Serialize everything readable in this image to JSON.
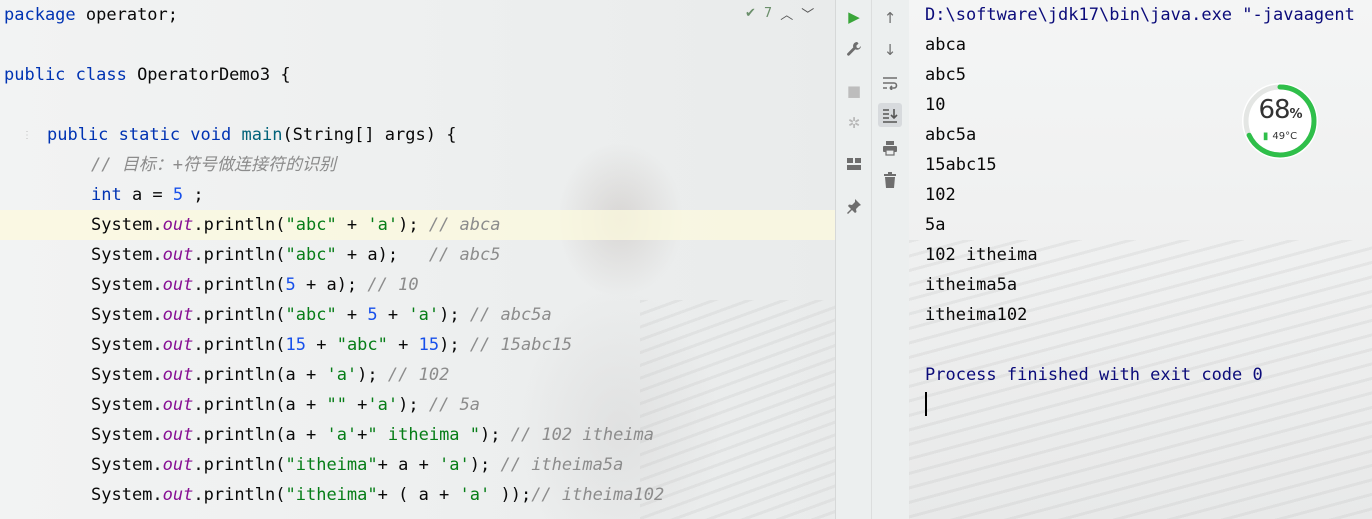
{
  "editor": {
    "inspection_count": "7",
    "code": {
      "l1_kw": "package",
      "l1_rest": " operator;",
      "l3_kw": "public class",
      "l3_rest": " OperatorDemo3 {",
      "l5_kw": "public static void",
      "l5_fn": "main",
      "l5_rest": "(String[] args) {",
      "l6_cmt": "// 目标：+符号做连接符的识别",
      "l7_kw": "int",
      "l7_mid": " a = ",
      "l7_num": "5",
      "l7_end": " ;",
      "sys": "System.",
      "out": "out",
      "println": ".println(",
      "l8_s": "\"abc\"",
      "l8_op": " + ",
      "l8_c": "'a'",
      "l8_end": "); ",
      "l8_cmt": "// abca",
      "l9_s": "\"abc\"",
      "l9_op": " + a);   ",
      "l9_cmt": "// abc5",
      "l10_n": "5",
      "l10_op": " + a); ",
      "l10_cmt": "// 10",
      "l11_s": "\"abc\"",
      "l11_op1": " + ",
      "l11_n": "5",
      "l11_op2": " + ",
      "l11_c": "'a'",
      "l11_end": "); ",
      "l11_cmt": "// abc5a",
      "l12_n1": "15",
      "l12_op1": " + ",
      "l12_s": "\"abc\"",
      "l12_op2": " + ",
      "l12_n2": "15",
      "l12_end": "); ",
      "l12_cmt": "// 15abc15",
      "l13_pre": "a + ",
      "l13_c": "'a'",
      "l13_end": "); ",
      "l13_cmt": "// 102",
      "l14_pre": "a + ",
      "l14_s": "\"\"",
      "l14_op": " +",
      "l14_c": "'a'",
      "l14_end": "); ",
      "l14_cmt": "// 5a",
      "l15_pre": "a + ",
      "l15_c": "'a'",
      "l15_op": "+",
      "l15_s": "\" itheima \"",
      "l15_end": "); ",
      "l15_cmt": "// 102 itheima",
      "l16_s": "\"itheima\"",
      "l16_op1": "+ a + ",
      "l16_c": "'a'",
      "l16_end": "); ",
      "l16_cmt": "// itheima5a",
      "l17_s": "\"itheima\"",
      "l17_op1": "+ ( a + ",
      "l17_c": "'a'",
      "l17_end": " ));",
      "l17_cmt": "// itheima102"
    }
  },
  "run_toolbar": {
    "icons": [
      "run-icon",
      "wrench-icon",
      "stop-icon",
      "debug-icon",
      "layout-icon",
      "pin-icon"
    ]
  },
  "console_toolbar": {
    "icons": [
      "arrow-up-icon",
      "arrow-down-icon",
      "soft-wrap-icon",
      "scroll-to-end-icon",
      "print-icon",
      "trash-icon"
    ]
  },
  "console": {
    "command": "D:\\software\\jdk17\\bin\\java.exe \"-javaagent",
    "output": [
      "abca",
      "abc5",
      "10",
      "abc5a",
      "15abc15",
      "102",
      "5a",
      "102 itheima",
      "itheima5a",
      "itheima102"
    ],
    "exit_message": "Process finished with exit code 0"
  },
  "cpu_widget": {
    "usage_value": "68",
    "usage_unit": "%",
    "usage_fraction": 0.68,
    "temperature": "49°C",
    "ring_color": "#2fbf4a"
  }
}
